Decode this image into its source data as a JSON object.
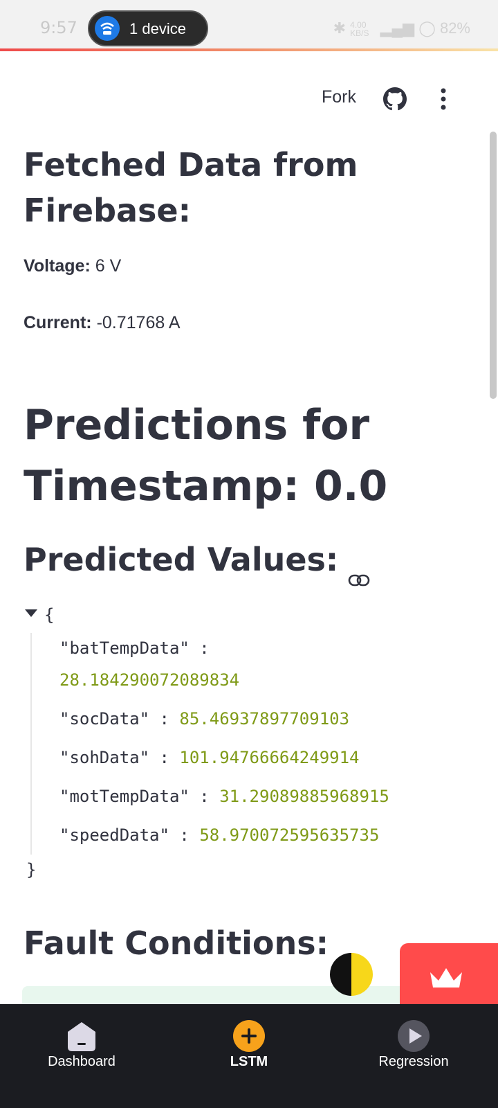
{
  "status_bar": {
    "time": "9:57",
    "pill_label": "1 device",
    "net_speed_top": "4.00",
    "net_speed_bottom": "KB/S",
    "battery": "82%"
  },
  "toolbar": {
    "fork_label": "Fork"
  },
  "fetched": {
    "title": "Fetched Data from Firebase:",
    "voltage_label": "Voltage:",
    "voltage_value": "6 V",
    "current_label": "Current:",
    "current_value": "-0.71768 A"
  },
  "predictions": {
    "title": "Predictions for Timestamp: 0.0",
    "values_title": "Predicted Values:",
    "json_open": "{",
    "json_close": "}",
    "entries": [
      {
        "key": "\"batTempData\"",
        "value": "28.184290072089834"
      },
      {
        "key": "\"socData\"",
        "value": "85.46937897709103"
      },
      {
        "key": "\"sohData\"",
        "value": "101.94766664249914"
      },
      {
        "key": "\"motTempData\"",
        "value": "31.29089885968915"
      },
      {
        "key": "\"speedData\"",
        "value": "58.970072595635735"
      }
    ]
  },
  "fault": {
    "title": "Fault Conditions:"
  },
  "bottom_nav": {
    "items": [
      {
        "label": "Dashboard",
        "icon": "dashboard-icon"
      },
      {
        "label": "LSTM",
        "icon": "plus-circle-icon"
      },
      {
        "label": "Regression",
        "icon": "play-circle-icon"
      }
    ],
    "active_index": 1
  },
  "colors": {
    "accent": "#ff4b4b",
    "json_number": "#7f9a17",
    "nav_bg": "#1b1c21",
    "lstm_icon": "#f7a21b"
  }
}
